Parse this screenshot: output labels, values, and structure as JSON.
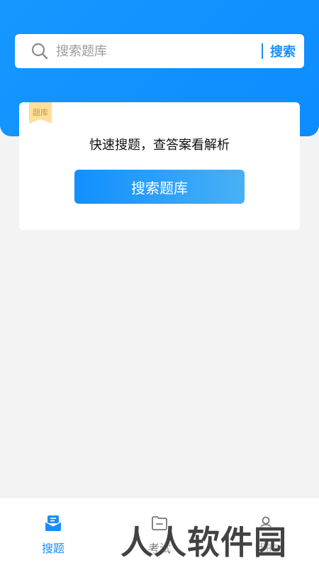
{
  "search": {
    "placeholder": "搜索题库",
    "button_label": "搜索"
  },
  "card": {
    "ribbon_label": "题库",
    "subtitle": "快速搜题，查答案看解析",
    "button_label": "搜索题库"
  },
  "tabbar": {
    "tabs": [
      {
        "label": "搜题",
        "icon": "search-question-icon",
        "active": true
      },
      {
        "label": "考试",
        "icon": "exam-folder-icon",
        "active": false
      },
      {
        "label": "我的",
        "icon": "profile-icon",
        "active": false
      }
    ]
  },
  "watermark": "人人软件园",
  "colors": {
    "accent": "#1b8ef8",
    "header": "#0d8cff",
    "ribbon": "#ffdf9a",
    "background": "#f3f3f3"
  }
}
